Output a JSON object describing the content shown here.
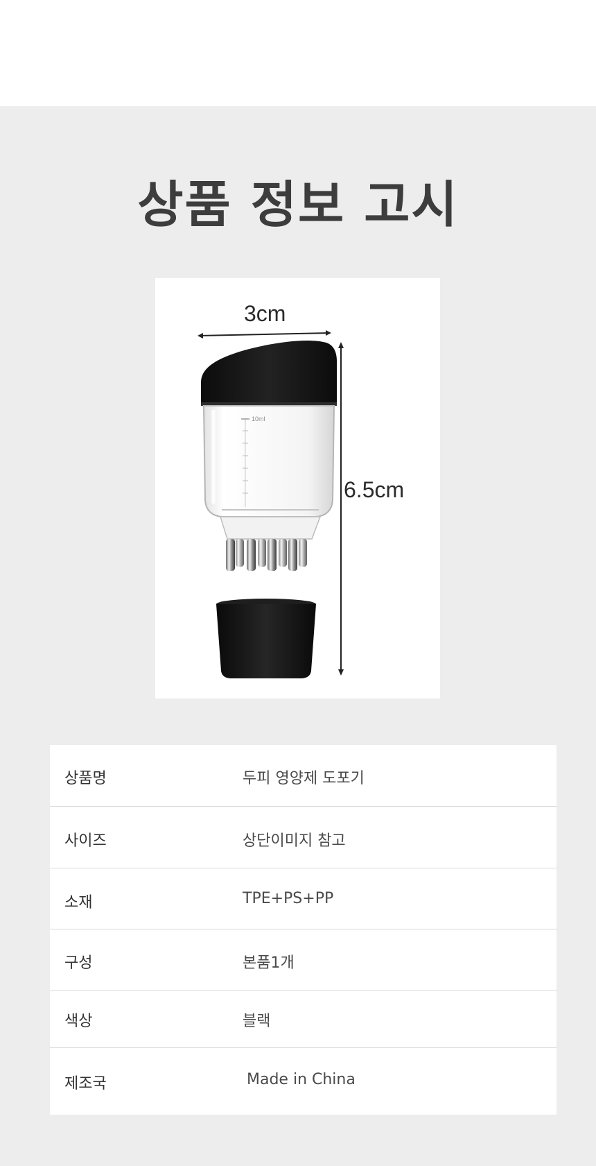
{
  "title": "상품 정보 고시",
  "figure": {
    "width_label": "3cm",
    "height_label": "6.5cm",
    "scale_marking": "10ml"
  },
  "info_table": {
    "rows": [
      {
        "label": "상품명",
        "value": "두피 영양제 도포기"
      },
      {
        "label": "사이즈",
        "value": "상단이미지 참고"
      },
      {
        "label": "소재",
        "value": "TPE+PS+PP"
      },
      {
        "label": "구성",
        "value": "본품1개"
      },
      {
        "label": "색상",
        "value": "블랙"
      },
      {
        "label": "제조국",
        "value": "Made in China"
      }
    ]
  },
  "colors": {
    "background": "#ededed",
    "title": "#3d3d3d",
    "product_black": "#111111"
  }
}
